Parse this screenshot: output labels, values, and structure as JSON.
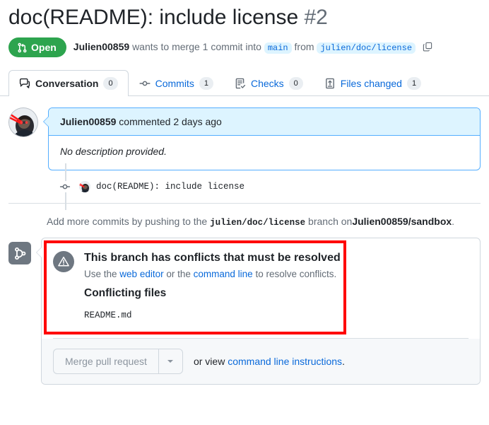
{
  "header": {
    "title": "doc(README): include license",
    "number": "#2",
    "state_badge": {
      "label": "Open",
      "icon": "pull-request-icon",
      "color": "#2da44e"
    },
    "byline": {
      "author": "Julien00859",
      "text_before_base": "wants to merge 1 commit into",
      "base_branch": "main",
      "from_word": "from",
      "head_branch": "julien/doc/license",
      "copy_icon": "copy-icon"
    }
  },
  "tabs": [
    {
      "label": "Conversation",
      "count": "0",
      "icon": "comment-icon",
      "selected": true
    },
    {
      "label": "Commits",
      "count": "1",
      "icon": "commit-icon",
      "selected": false
    },
    {
      "label": "Checks",
      "count": "0",
      "icon": "checklist-icon",
      "selected": false
    },
    {
      "label": "Files changed",
      "count": "1",
      "icon": "file-diff-icon",
      "selected": false
    }
  ],
  "comment": {
    "avatar": "user-avatar",
    "author": "Julien00859",
    "meta": "commented 2 days ago",
    "body": "No description provided."
  },
  "commit": {
    "node_icon": "commit-node-icon",
    "avatar": "commit-author-avatar",
    "message": "doc(README): include license"
  },
  "push_hint": {
    "prefix": "Add more commits by pushing to the",
    "branch": "julien/doc/license",
    "middle": "branch on",
    "repo": "Julien00859/sandbox",
    "suffix": "."
  },
  "merge": {
    "state_icon": "git-merge-icon",
    "conflict": {
      "icon": "alert-triangle-icon",
      "title": "This branch has conflicts that must be resolved",
      "subtitle_prefix": "Use the",
      "link_web_editor": "web editor",
      "subtitle_middle": "or the",
      "link_command_line": "command line",
      "subtitle_suffix": "to resolve conflicts.",
      "files_heading": "Conflicting files",
      "files": [
        "README.md"
      ],
      "highlight_color": "#ff0000"
    },
    "actions": {
      "merge_button": "Merge pull request",
      "dropdown_icon": "chevron-down-icon",
      "note_prefix": "or view",
      "note_link": "command line instructions",
      "note_suffix": "."
    }
  }
}
